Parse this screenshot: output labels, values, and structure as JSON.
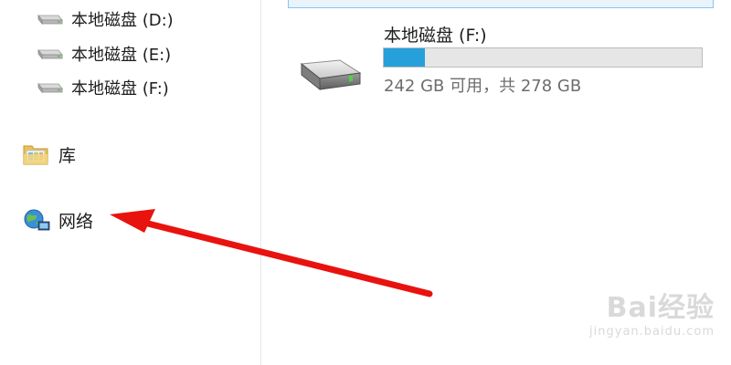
{
  "nav_pane": {
    "drives": [
      {
        "label": "本地磁盘 (D:)",
        "icon": "hard-drive-icon"
      },
      {
        "label": "本地磁盘 (E:)",
        "icon": "hard-drive-icon"
      },
      {
        "label": "本地磁盘 (F:)",
        "icon": "hard-drive-icon"
      }
    ],
    "library": {
      "label": "库",
      "icon": "library-folder-icon"
    },
    "network": {
      "label": "网络",
      "icon": "network-globe-icon"
    }
  },
  "content": {
    "drive_tile": {
      "name": "本地磁盘 (F:)",
      "space_text": "242 GB 可用，共 278 GB",
      "used_fraction": 0.13,
      "icon": "hard-drive-icon"
    }
  },
  "annotation": {
    "arrow_color": "#e8130e",
    "points_to": "network"
  },
  "watermark": {
    "main": "Bai经验",
    "url": "jingyan.baidu.com"
  },
  "colors": {
    "usage_fill": "#26a0da",
    "usage_track": "#e6e6e6",
    "selection_border": "#8cc3ec"
  }
}
